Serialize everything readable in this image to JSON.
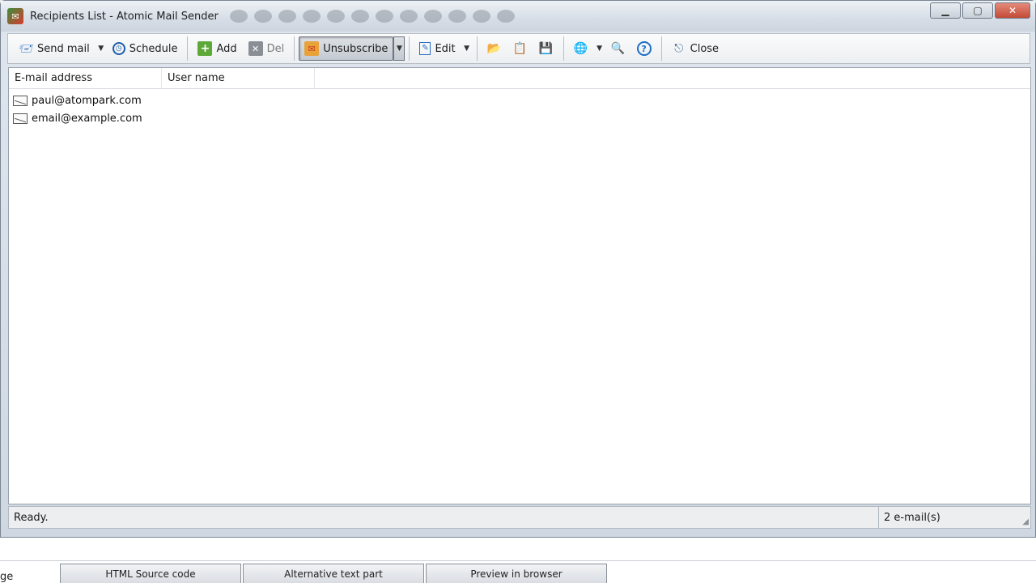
{
  "window": {
    "title": "Recipients List - Atomic Mail Sender"
  },
  "toolbar": {
    "send_mail": "Send mail",
    "schedule": "Schedule",
    "add": "Add",
    "del": "Del",
    "unsubscribe": "Unsubscribe",
    "edit": "Edit",
    "close": "Close"
  },
  "list": {
    "columns": [
      "E-mail address",
      "User name"
    ],
    "rows": [
      {
        "email": "paul@atompark.com",
        "user_name": ""
      },
      {
        "email": "email@example.com",
        "user_name": ""
      }
    ]
  },
  "status": {
    "left": "Ready.",
    "right": "2 e-mail(s)"
  },
  "background_app": {
    "cut_label": "ge",
    "tabs": [
      "HTML Source code",
      "Alternative text part",
      "Preview in browser"
    ]
  },
  "icons": [
    "app-icon",
    "send-mail-icon",
    "clock-icon",
    "add-icon",
    "delete-icon",
    "unsubscribe-icon",
    "edit-icon",
    "folder-open-icon",
    "clipboard-icon",
    "save-icon",
    "globe-icon",
    "search-icon",
    "help-icon",
    "close-window-icon",
    "email-row-icon"
  ]
}
